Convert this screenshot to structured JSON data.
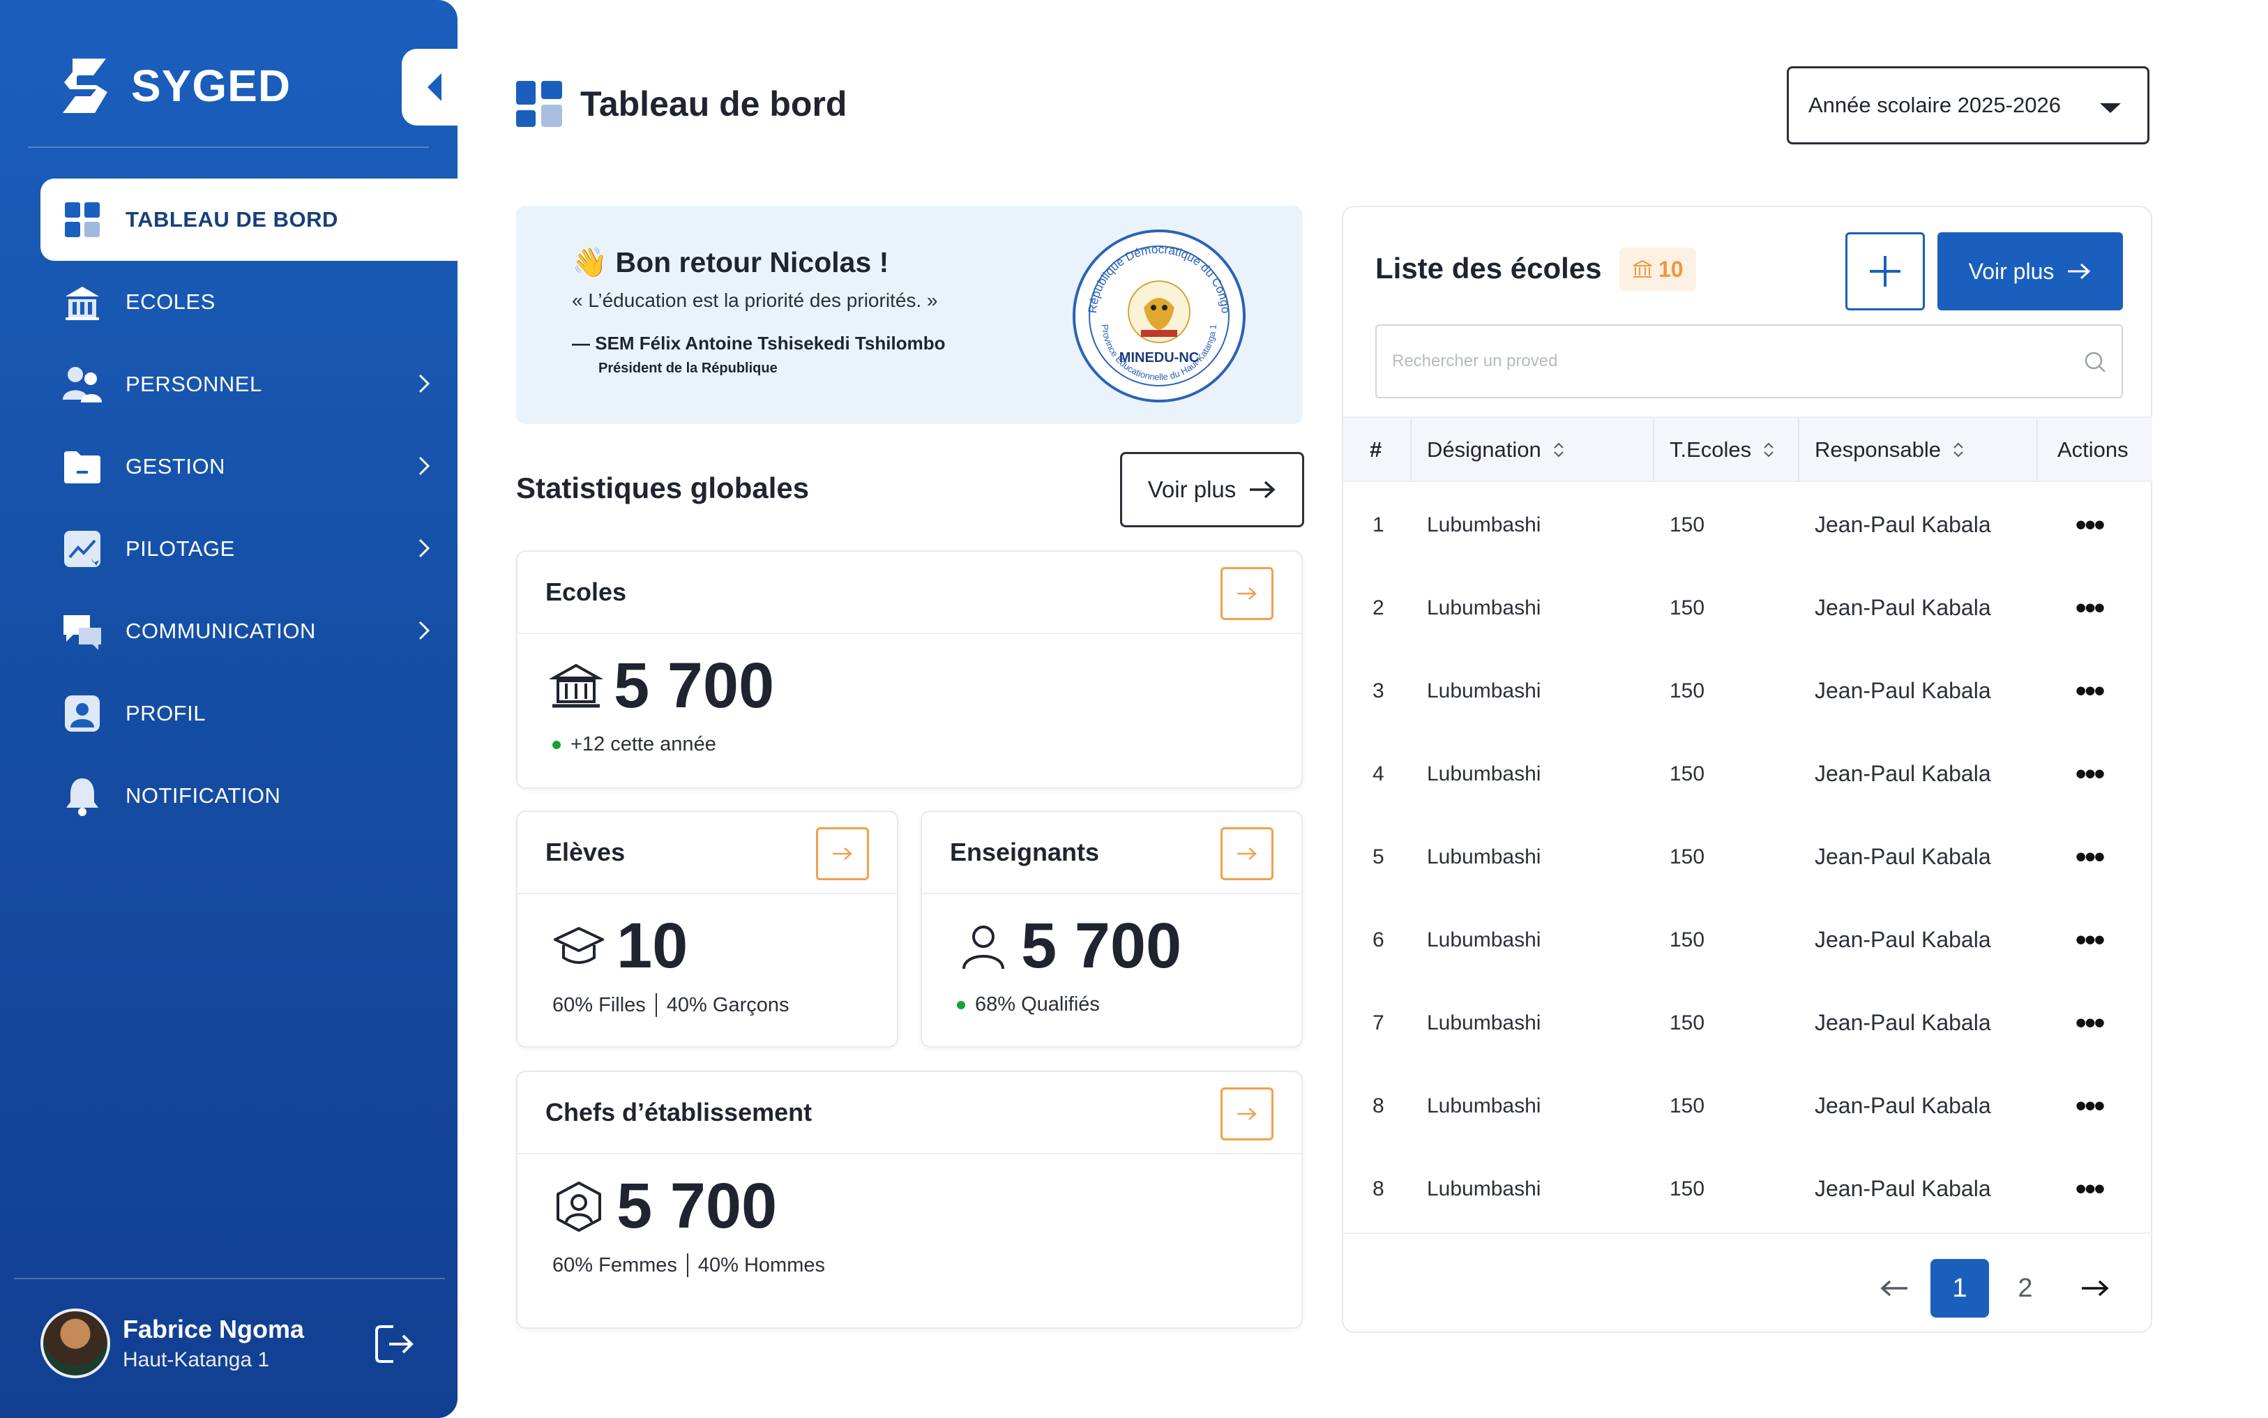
{
  "app": {
    "name": "SYGED"
  },
  "sidebar": {
    "items": [
      {
        "label": "TABLEAU DE BORD",
        "icon": "dashboard-icon",
        "active": true
      },
      {
        "label": "ECOLES",
        "icon": "school-icon"
      },
      {
        "label": "PERSONNEL",
        "icon": "people-icon",
        "submenu": true
      },
      {
        "label": "GESTION",
        "icon": "folder-icon",
        "submenu": true
      },
      {
        "label": "PILOTAGE",
        "icon": "chart-icon",
        "submenu": true
      },
      {
        "label": "COMMUNICATION",
        "icon": "chat-icon",
        "submenu": true
      },
      {
        "label": "PROFIL",
        "icon": "user-icon"
      },
      {
        "label": "NOTIFICATION",
        "icon": "bell-icon"
      }
    ],
    "user": {
      "name": "Fabrice Ngoma",
      "region": "Haut-Katanga 1"
    }
  },
  "header": {
    "title": "Tableau de bord",
    "year_select": "Année scolaire 2025-2026"
  },
  "welcome": {
    "emoji": "👋",
    "greeting": "Bon retour Nicolas !",
    "quote": "« L’éducation est la priorité des priorités. »",
    "author": "— SEM Félix Antoine Tshisekedi Tshilombo",
    "author_title": "Président de la République",
    "seal_top": "République Démocratique du Congo",
    "seal_bottom": "Province Educationnelle du Haut-Katanga 1",
    "seal_label": "MINEDU-NC"
  },
  "stats": {
    "title": "Statistiques globales",
    "voir_plus": "Voir plus",
    "ecoles": {
      "title": "Ecoles",
      "value": "5 700",
      "note": "+12 cette année"
    },
    "eleves": {
      "title": "Elèves",
      "value": "10",
      "left": "60% Filles",
      "right": "40% Garçons"
    },
    "enseignants": {
      "title": "Enseignants",
      "value": "5 700",
      "note": "68% Qualifiés"
    },
    "chefs": {
      "title": "Chefs d’établissement",
      "value": "5 700",
      "left": "60% Femmes",
      "right": "40% Hommes"
    }
  },
  "schools": {
    "title": "Liste des écoles",
    "count": "10",
    "voir_plus": "Voir plus",
    "search_placeholder": "Rechercher un proved",
    "columns": {
      "num": "#",
      "designation": "Désignation",
      "tecoles": "T.Ecoles",
      "responsable": "Responsable",
      "actions": "Actions"
    },
    "rows": [
      {
        "num": "1",
        "designation": "Lubumbashi",
        "tecoles": "150",
        "responsable": "Jean-Paul Kabala",
        "actions": "•••"
      },
      {
        "num": "2",
        "designation": "Lubumbashi",
        "tecoles": "150",
        "responsable": "Jean-Paul Kabala",
        "actions": "•••"
      },
      {
        "num": "3",
        "designation": "Lubumbashi",
        "tecoles": "150",
        "responsable": "Jean-Paul Kabala",
        "actions": "•••"
      },
      {
        "num": "4",
        "designation": "Lubumbashi",
        "tecoles": "150",
        "responsable": "Jean-Paul Kabala",
        "actions": "•••"
      },
      {
        "num": "5",
        "designation": "Lubumbashi",
        "tecoles": "150",
        "responsable": "Jean-Paul Kabala",
        "actions": "•••"
      },
      {
        "num": "6",
        "designation": "Lubumbashi",
        "tecoles": "150",
        "responsable": "Jean-Paul Kabala",
        "actions": "•••"
      },
      {
        "num": "7",
        "designation": "Lubumbashi",
        "tecoles": "150",
        "responsable": "Jean-Paul Kabala",
        "actions": "•••"
      },
      {
        "num": "8",
        "designation": "Lubumbashi",
        "tecoles": "150",
        "responsable": "Jean-Paul Kabala",
        "actions": "•••"
      },
      {
        "num": "8",
        "designation": "Lubumbashi",
        "tecoles": "150",
        "responsable": "Jean-Paul Kabala",
        "actions": "•••"
      }
    ],
    "pagination": {
      "current": "1",
      "next_page": "2"
    }
  },
  "colors": {
    "primary": "#1a5fbd",
    "accent": "#f1a04c",
    "positive": "#17a13a"
  }
}
